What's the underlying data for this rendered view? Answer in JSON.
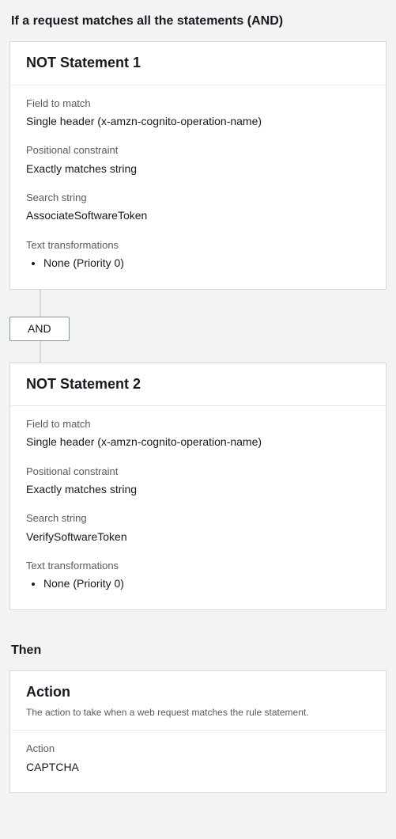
{
  "match_heading": "If a request matches all the statements (AND)",
  "statements": [
    {
      "title": "NOT Statement 1",
      "field_to_match_label": "Field to match",
      "field_to_match_value": "Single header (x-amzn-cognito-operation-name)",
      "positional_label": "Positional constraint",
      "positional_value": "Exactly matches string",
      "search_label": "Search string",
      "search_value": "AssociateSoftwareToken",
      "transform_label": "Text transformations",
      "transform_item": "None (Priority 0)"
    },
    {
      "title": "NOT Statement 2",
      "field_to_match_label": "Field to match",
      "field_to_match_value": "Single header (x-amzn-cognito-operation-name)",
      "positional_label": "Positional constraint",
      "positional_value": "Exactly matches string",
      "search_label": "Search string",
      "search_value": "VerifySoftwareToken",
      "transform_label": "Text transformations",
      "transform_item": "None (Priority 0)"
    }
  ],
  "connector_label": "AND",
  "then_heading": "Then",
  "action_card": {
    "title": "Action",
    "subtitle": "The action to take when a web request matches the rule statement.",
    "action_label": "Action",
    "action_value": "CAPTCHA"
  }
}
